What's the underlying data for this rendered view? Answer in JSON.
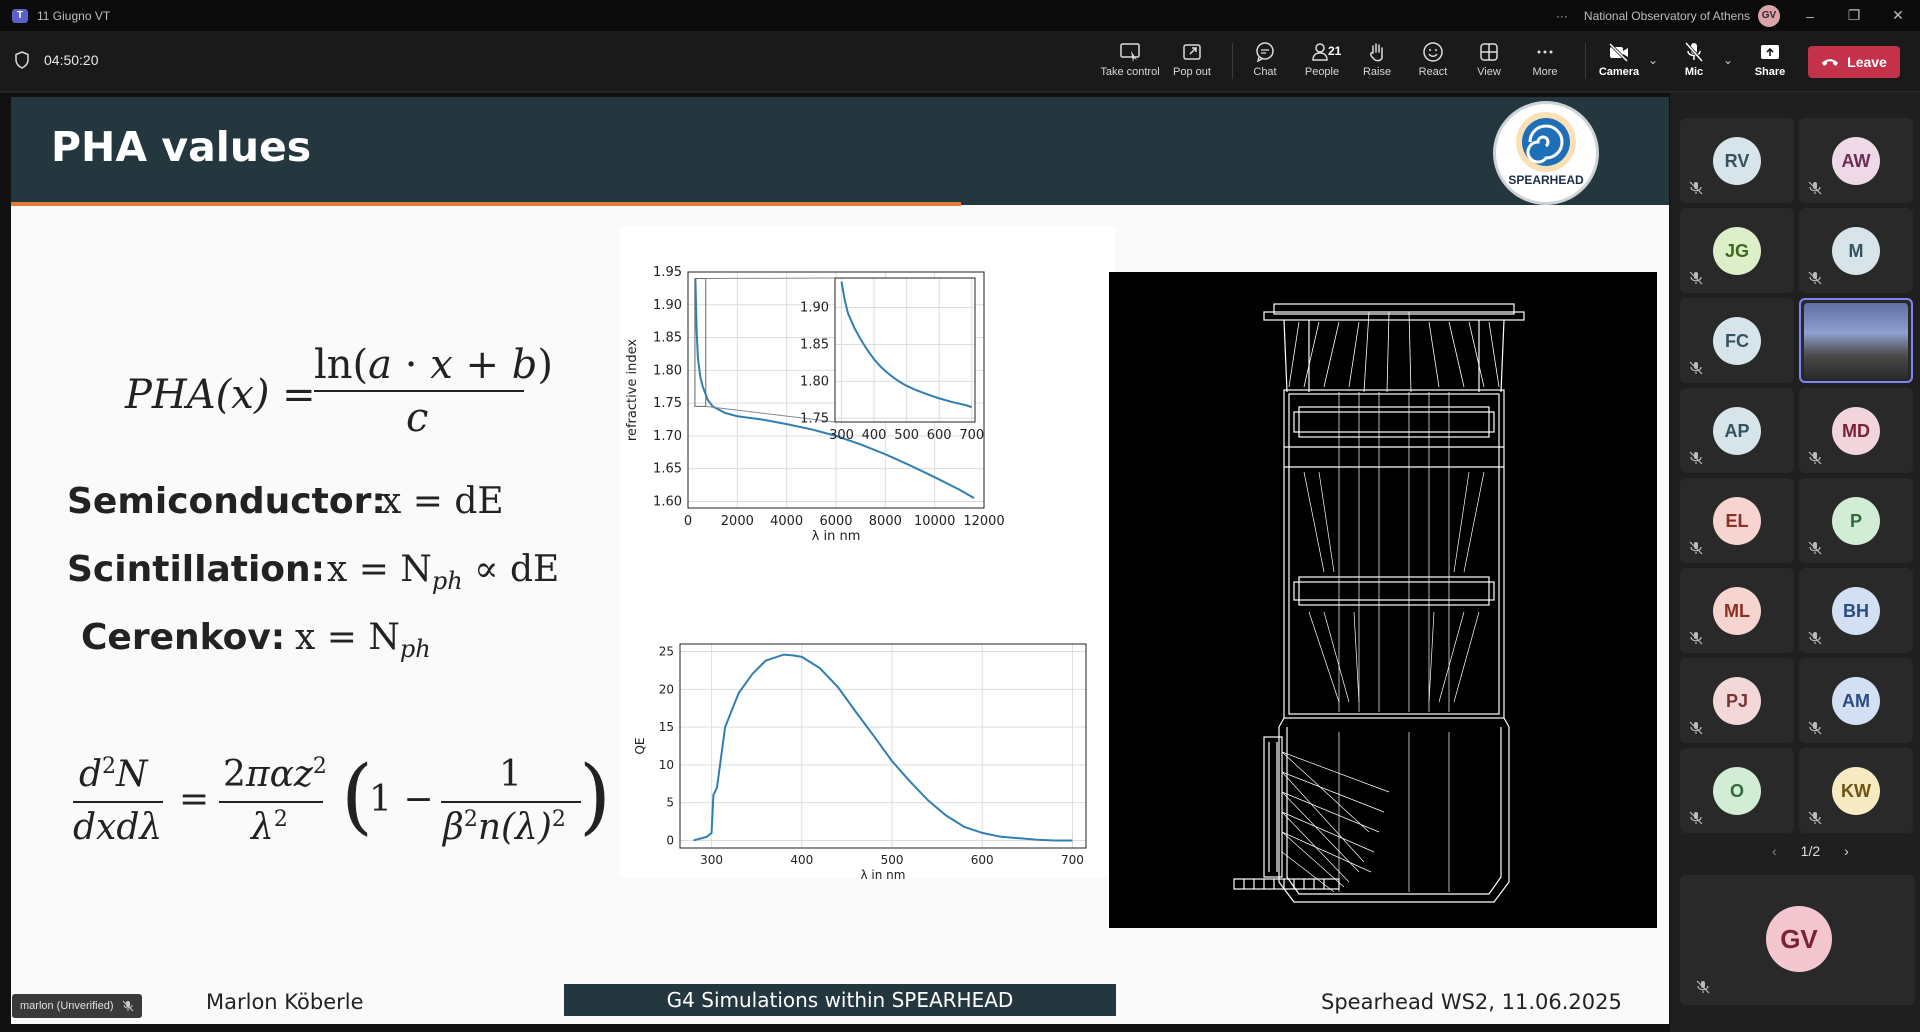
{
  "window": {
    "title": "11 Giugno VT",
    "org": "National Observatory of Athens",
    "user_initials": "GV"
  },
  "toolbar": {
    "timer": "04:50:20",
    "buttons": [
      {
        "id": "take_control",
        "label": "Take control"
      },
      {
        "id": "pop_out",
        "label": "Pop out"
      },
      {
        "id": "chat",
        "label": "Chat"
      },
      {
        "id": "people",
        "label": "People",
        "count": "21"
      },
      {
        "id": "raise",
        "label": "Raise"
      },
      {
        "id": "react",
        "label": "React"
      },
      {
        "id": "view",
        "label": "View"
      },
      {
        "id": "more",
        "label": "More"
      },
      {
        "id": "camera",
        "label": "Camera"
      },
      {
        "id": "mic",
        "label": "Mic"
      },
      {
        "id": "share",
        "label": "Share"
      }
    ],
    "leave": "Leave"
  },
  "slide": {
    "title": "PHA values",
    "logo_text": "SPEARHEAD",
    "labels": {
      "semi": "Semiconductor:",
      "scint": "Scintillation:",
      "ceren": "Cerenkov:"
    },
    "footer_left": "Marlon Köberle",
    "footer_mid": "G4 Simulations within SPEARHEAD",
    "footer_right": "Spearhead WS2, 11.06.2025"
  },
  "chart_data": [
    {
      "type": "line",
      "xlabel": "λ in nm",
      "ylabel": "refractive index",
      "xlim": [
        0,
        12000
      ],
      "ylim": [
        1.59,
        1.95
      ],
      "x_ticks": [
        "0",
        "2000",
        "4000",
        "6000",
        "8000",
        "10000",
        "12000"
      ],
      "y_ticks": [
        "1.60",
        "1.65",
        "1.70",
        "1.75",
        "1.80",
        "1.85",
        "1.90",
        "1.95"
      ],
      "grid": true,
      "series": [
        {
          "x": [
            300,
            350,
            400,
            500,
            600,
            800,
            1000,
            1500,
            2000,
            3000,
            4000,
            5000,
            6000,
            7000,
            8000,
            9000,
            10000,
            11000,
            11600
          ],
          "y": [
            1.94,
            1.86,
            1.82,
            1.79,
            1.775,
            1.755,
            1.745,
            1.735,
            1.73,
            1.725,
            1.718,
            1.71,
            1.7,
            1.687,
            1.672,
            1.655,
            1.637,
            1.618,
            1.605
          ]
        }
      ],
      "inset": {
        "xlim": [
          280,
          710
        ],
        "ylim": [
          1.745,
          1.94
        ],
        "x_ticks": [
          "300",
          "400",
          "500",
          "600",
          "700"
        ],
        "y_ticks": [
          "1.75",
          "1.80",
          "1.85",
          "1.90"
        ],
        "series": [
          {
            "x": [
              300,
              310,
              320,
              340,
              360,
              380,
              400,
              420,
              440,
              460,
              480,
              500,
              530,
              560,
              600,
              640,
              680,
              700
            ],
            "y": [
              1.935,
              1.91,
              1.892,
              1.872,
              1.856,
              1.842,
              1.83,
              1.82,
              1.812,
              1.805,
              1.799,
              1.794,
              1.788,
              1.783,
              1.777,
              1.772,
              1.768,
              1.765
            ]
          }
        ]
      }
    },
    {
      "type": "line",
      "xlabel": "λ in nm",
      "ylabel": "QE",
      "xlim": [
        265,
        715
      ],
      "ylim": [
        -1,
        26
      ],
      "x_ticks": [
        "300",
        "400",
        "500",
        "600",
        "700"
      ],
      "y_ticks": [
        "0",
        "5",
        "10",
        "15",
        "20",
        "25"
      ],
      "grid": true,
      "series": [
        {
          "x": [
            280,
            295,
            300,
            302,
            306,
            315,
            330,
            345,
            360,
            380,
            390,
            400,
            420,
            440,
            460,
            480,
            500,
            520,
            540,
            560,
            580,
            600,
            620,
            640,
            660,
            680,
            700
          ],
          "y": [
            0,
            0.5,
            1.0,
            6.0,
            7.0,
            15,
            19.5,
            22,
            23.8,
            24.6,
            24.5,
            24.3,
            22.8,
            20.3,
            17.0,
            13.8,
            10.5,
            7.8,
            5.3,
            3.3,
            1.8,
            1.0,
            0.5,
            0.3,
            0.1,
            0.0,
            0.0
          ]
        }
      ]
    }
  ],
  "participants": [
    {
      "initials": "RV",
      "color": "#d7e4ea",
      "text": "#33535f"
    },
    {
      "initials": "AW",
      "color": "#eed9e7",
      "text": "#6b2f55"
    },
    {
      "initials": "JG",
      "color": "#dcefc9",
      "text": "#3d6a1e"
    },
    {
      "initials": "M",
      "color": "#d7e4ea",
      "text": "#33535f"
    },
    {
      "initials": "FC",
      "color": "#d7e4ea",
      "text": "#33535f"
    },
    {
      "initials": "",
      "color": "#3a4a6a",
      "text": "#fff"
    },
    {
      "initials": "AP",
      "color": "#d7e4ea",
      "text": "#33535f"
    },
    {
      "initials": "MD",
      "color": "#f2d5dc",
      "text": "#7a2238"
    },
    {
      "initials": "EL",
      "color": "#f6d4cf",
      "text": "#8a2f22"
    },
    {
      "initials": "P",
      "color": "#d3ecd6",
      "text": "#2e6a3b"
    },
    {
      "initials": "ML",
      "color": "#f6d4cf",
      "text": "#8a2f22"
    },
    {
      "initials": "BH",
      "color": "#d3e0f3",
      "text": "#2a4d80"
    },
    {
      "initials": "PJ",
      "color": "#f2d8d8",
      "text": "#7a3434"
    },
    {
      "initials": "AM",
      "color": "#d3e0f3",
      "text": "#2a4d80"
    },
    {
      "initials": "O",
      "color": "#d3ecd6",
      "text": "#2e6a3b"
    },
    {
      "initials": "KW",
      "color": "#f6eac2",
      "text": "#6e5412"
    }
  ],
  "pager": "1/2",
  "self_tile": {
    "initials": "GV"
  },
  "presenter_tag": "marlon (Unverified)"
}
